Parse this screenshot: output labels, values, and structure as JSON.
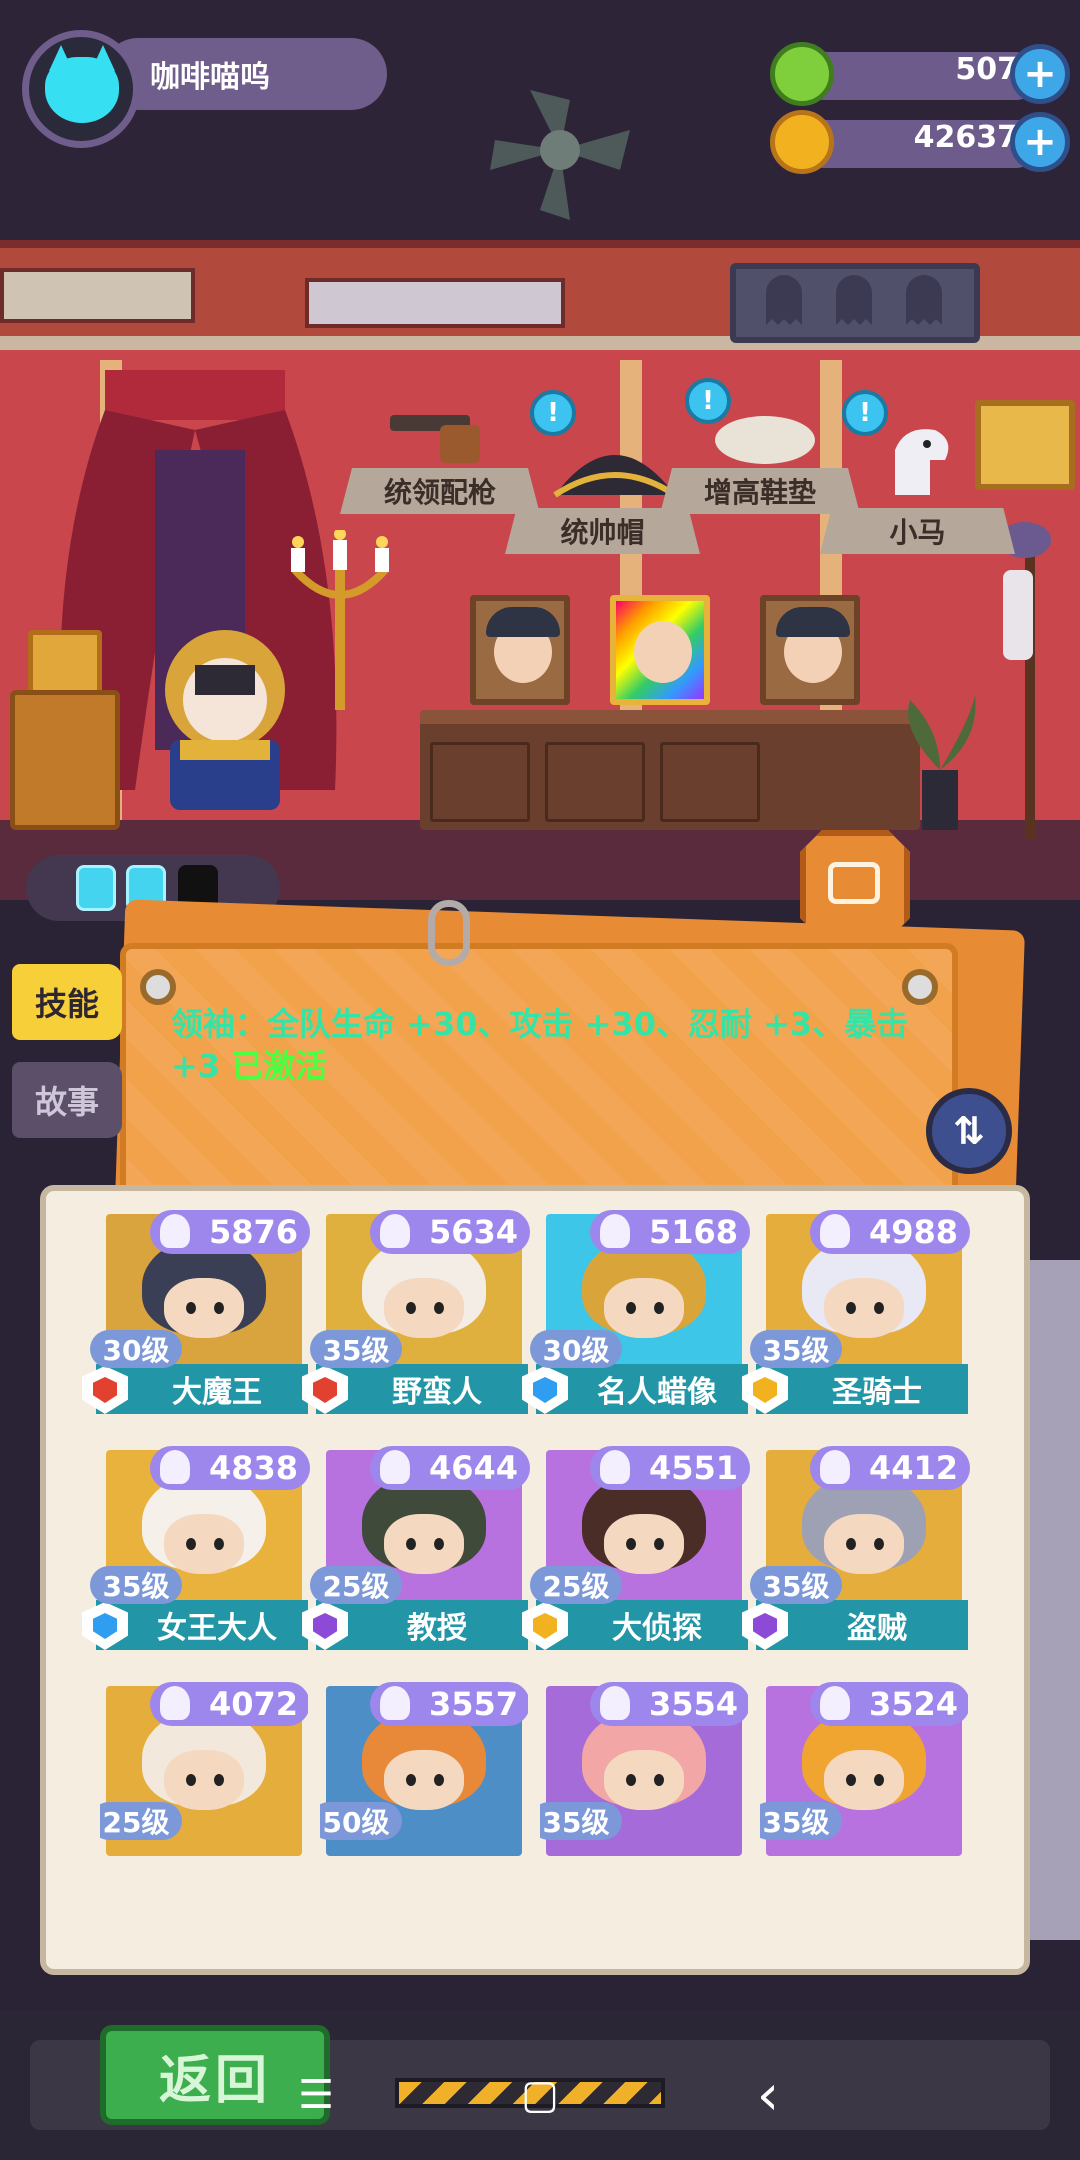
{
  "player": {
    "name": "咖啡喵呜"
  },
  "currencies": [
    {
      "id": "gem",
      "value": "507",
      "color": "#7fcf3c"
    },
    {
      "id": "coin",
      "value": "42637",
      "color": "#f2b21f"
    }
  ],
  "plus_symbol": "+",
  "equipment": [
    {
      "label": "统领配枪",
      "icon": "pistol-icon",
      "alert": false
    },
    {
      "label": "统帅帽",
      "icon": "bicorne-hat-icon",
      "alert": true
    },
    {
      "label": "增高鞋垫",
      "icon": "shoe-insole-icon",
      "alert": true
    },
    {
      "label": "小马",
      "icon": "pony-icon",
      "alert": true
    }
  ],
  "alert_symbol": "!",
  "energy": {
    "full": 2,
    "total": 3
  },
  "tabs": {
    "skill": "技能",
    "story": "故事"
  },
  "skill": {
    "text": "领袖：全队生命 +30、攻击 +30、忍耐 +3、暴击 +3 ",
    "status": "已激活"
  },
  "swap_symbol": "⇅",
  "heroes": [
    {
      "power": "5876",
      "level": "30级",
      "name": "大魔王",
      "rank": "red",
      "hair": "#3a3f55",
      "bg": "#d9a43d"
    },
    {
      "power": "5634",
      "level": "35级",
      "name": "野蛮人",
      "rank": "red",
      "hair": "#f3ede6",
      "bg": "#e0b03e"
    },
    {
      "power": "5168",
      "level": "30级",
      "name": "名人蜡像",
      "rank": "blue",
      "hair": "#d9a53a",
      "bg": "#3ec6e8"
    },
    {
      "power": "4988",
      "level": "35级",
      "name": "圣骑士",
      "rank": "gold",
      "hair": "#e9e8f5",
      "bg": "#e5ad3c"
    },
    {
      "power": "4838",
      "level": "35级",
      "name": "女王大人",
      "rank": "blue",
      "hair": "#f6f0ea",
      "bg": "#e8b23d"
    },
    {
      "power": "4644",
      "level": "25级",
      "name": "教授",
      "rank": "purple",
      "hair": "#3f4a3a",
      "bg": "#b872e0"
    },
    {
      "power": "4551",
      "level": "25级",
      "name": "大侦探",
      "rank": "gold",
      "hair": "#4a2d27",
      "bg": "#b872e0"
    },
    {
      "power": "4412",
      "level": "35级",
      "name": "盗贼",
      "rank": "purple",
      "hair": "#9ea0b4",
      "bg": "#e5ad3c"
    },
    {
      "power": "4072",
      "level": "25级",
      "rank": "none",
      "hair": "#f2e9dc",
      "bg": "#e5ad3c"
    },
    {
      "power": "3557",
      "level": "50级",
      "rank": "none",
      "hair": "#e8893a",
      "bg": "#4d8ec7"
    },
    {
      "power": "3554",
      "level": "35级",
      "rank": "none",
      "hair": "#f3a6a6",
      "bg": "#a46bd9"
    },
    {
      "power": "3524",
      "level": "35级",
      "rank": "none",
      "hair": "#f0a531",
      "bg": "#b872e0"
    }
  ],
  "rank_colors": {
    "red": "#e3412f",
    "blue": "#2f9df0",
    "gold": "#f2b21f",
    "purple": "#8c4ad6"
  },
  "back_button": "返回",
  "nav": {
    "menu": "☰",
    "home": "▢",
    "back": "‹"
  }
}
